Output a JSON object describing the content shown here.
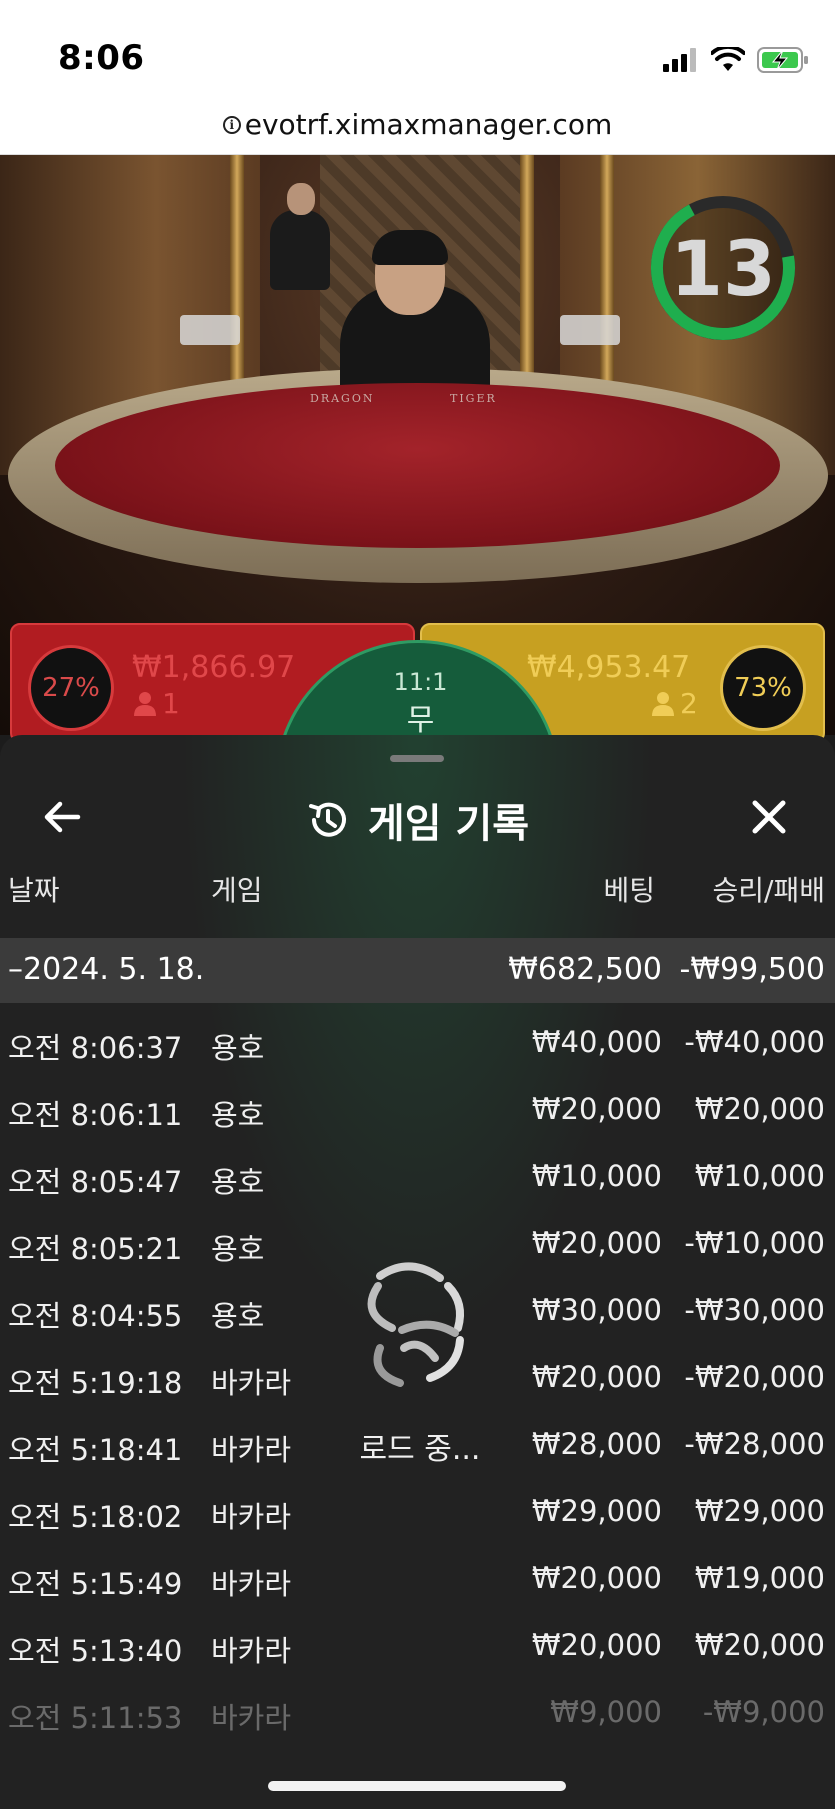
{
  "status_bar": {
    "time": "8:06"
  },
  "browser": {
    "url": "evotrf.ximaxmanager.com"
  },
  "video": {
    "timer": "13",
    "table_left_text": "DRAGON",
    "table_right_text": "TIGER"
  },
  "bets": {
    "dragon": {
      "percent": "27%",
      "amount": "₩1,866.97",
      "players": "1"
    },
    "tiger": {
      "percent": "73%",
      "amount": "₩4,953.47",
      "players": "2"
    },
    "tie": {
      "odds": "11:1",
      "label": "무"
    }
  },
  "history": {
    "title": "게임 기록",
    "columns": {
      "date": "날짜",
      "game": "게임",
      "bet": "베팅",
      "result": "승리/패배"
    },
    "date_group": {
      "date": "–2024. 5. 18.",
      "bet": "₩682,500",
      "result": "-₩99,500"
    },
    "rows": [
      {
        "time": "오전 8:06:37",
        "game": "용호",
        "bet": "₩40,000",
        "result": "-₩40,000"
      },
      {
        "time": "오전 8:06:11",
        "game": "용호",
        "bet": "₩20,000",
        "result": "₩20,000"
      },
      {
        "time": "오전 8:05:47",
        "game": "용호",
        "bet": "₩10,000",
        "result": "₩10,000"
      },
      {
        "time": "오전 8:05:21",
        "game": "용호",
        "bet": "₩20,000",
        "result": "-₩10,000"
      },
      {
        "time": "오전 8:04:55",
        "game": "용호",
        "bet": "₩30,000",
        "result": "-₩30,000"
      },
      {
        "time": "오전 5:19:18",
        "game": "바카라",
        "bet": "₩20,000",
        "result": "-₩20,000"
      },
      {
        "time": "오전 5:18:41",
        "game": "바카라",
        "bet": "₩28,000",
        "result": "-₩28,000"
      },
      {
        "time": "오전 5:18:02",
        "game": "바카라",
        "bet": "₩29,000",
        "result": "₩29,000"
      },
      {
        "time": "오전 5:15:49",
        "game": "바카라",
        "bet": "₩20,000",
        "result": "₩19,000"
      },
      {
        "time": "오전 5:13:40",
        "game": "바카라",
        "bet": "₩20,000",
        "result": "₩20,000"
      },
      {
        "time": "오전 5:11:53",
        "game": "바카라",
        "bet": "₩9,000",
        "result": "-₩9,000"
      }
    ],
    "loading_text": "로드 중..."
  },
  "colors": {
    "dragon_red": "#b11c21",
    "tiger_gold": "#c7a021",
    "tie_green": "#155c3b",
    "timer_green": "#1fae4e"
  },
  "icons": [
    "info-icon",
    "signal-icon",
    "wifi-icon",
    "battery-charging-icon",
    "back-arrow-icon",
    "history-icon",
    "close-icon",
    "person-icon",
    "loading-spinner-icon"
  ]
}
